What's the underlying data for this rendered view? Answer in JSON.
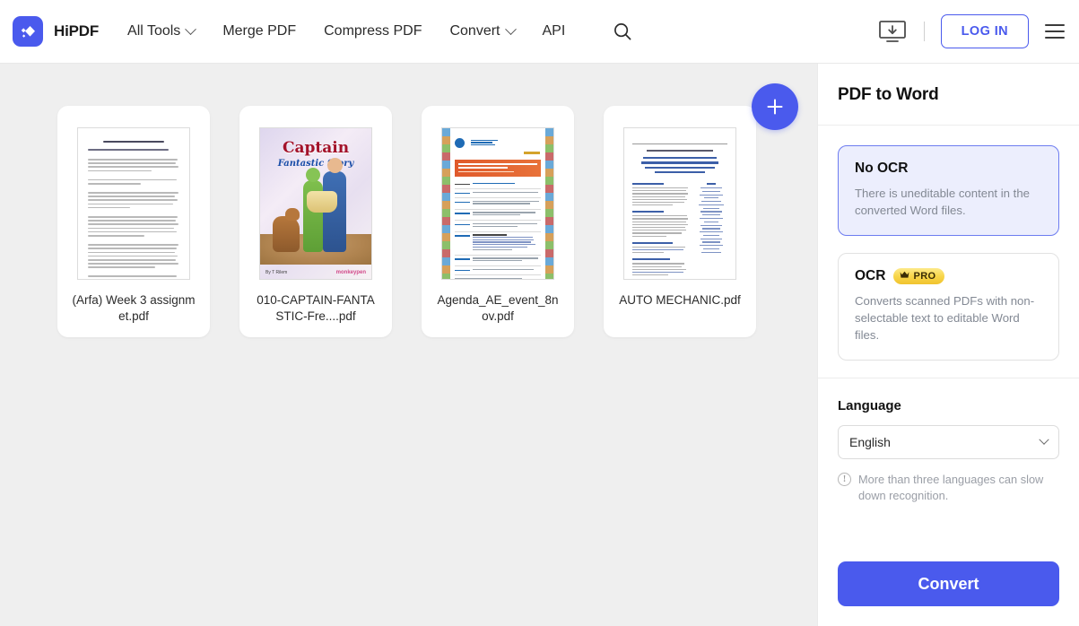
{
  "header": {
    "brand": "HiPDF",
    "logo_icon": "hipdf-diamond-logo",
    "nav": [
      {
        "label": "All Tools",
        "has_caret": true
      },
      {
        "label": "Merge PDF",
        "has_caret": false
      },
      {
        "label": "Compress PDF",
        "has_caret": false
      },
      {
        "label": "Convert",
        "has_caret": true
      },
      {
        "label": "API",
        "has_caret": false
      }
    ],
    "search_icon": "search-icon",
    "desktop_download_icon": "monitor-download-icon",
    "login_label": "LOG IN",
    "menu_icon": "hamburger-menu-icon",
    "accent_color": "#4a5aed"
  },
  "workspace": {
    "add_file_label": "+",
    "files": [
      {
        "name": "(Arfa) Week 3 assignmet.pdf",
        "thumb": "text-document"
      },
      {
        "name": "010-CAPTAIN-FANTASTIC-Fre....pdf",
        "thumb": "comic-cover"
      },
      {
        "name": "Agenda_AE_event_8nov.pdf",
        "thumb": "agenda-document"
      },
      {
        "name": "AUTO MECHANIC.pdf",
        "thumb": "two-column-document"
      }
    ],
    "comic": {
      "title": "Captain",
      "subtitle": "Fantastic Story",
      "credit": "By T Rilem",
      "publisher": "monkeypen"
    },
    "background_color": "#efefef"
  },
  "sidebar": {
    "title": "PDF to Word",
    "options": [
      {
        "title": "No OCR",
        "description": "There is uneditable content in the converted Word files.",
        "selected": true,
        "badge": null
      },
      {
        "title": "OCR",
        "description": "Converts scanned PDFs with non-selectable text to editable Word files.",
        "selected": false,
        "badge": {
          "label": "PRO",
          "icon": "crown-icon",
          "color": "#f8d64a"
        }
      }
    ],
    "language": {
      "label": "Language",
      "selected": "English",
      "hint": "More than three languages can slow down recognition.",
      "hint_icon": "info-exclamation-icon"
    },
    "convert_label": "Convert"
  }
}
